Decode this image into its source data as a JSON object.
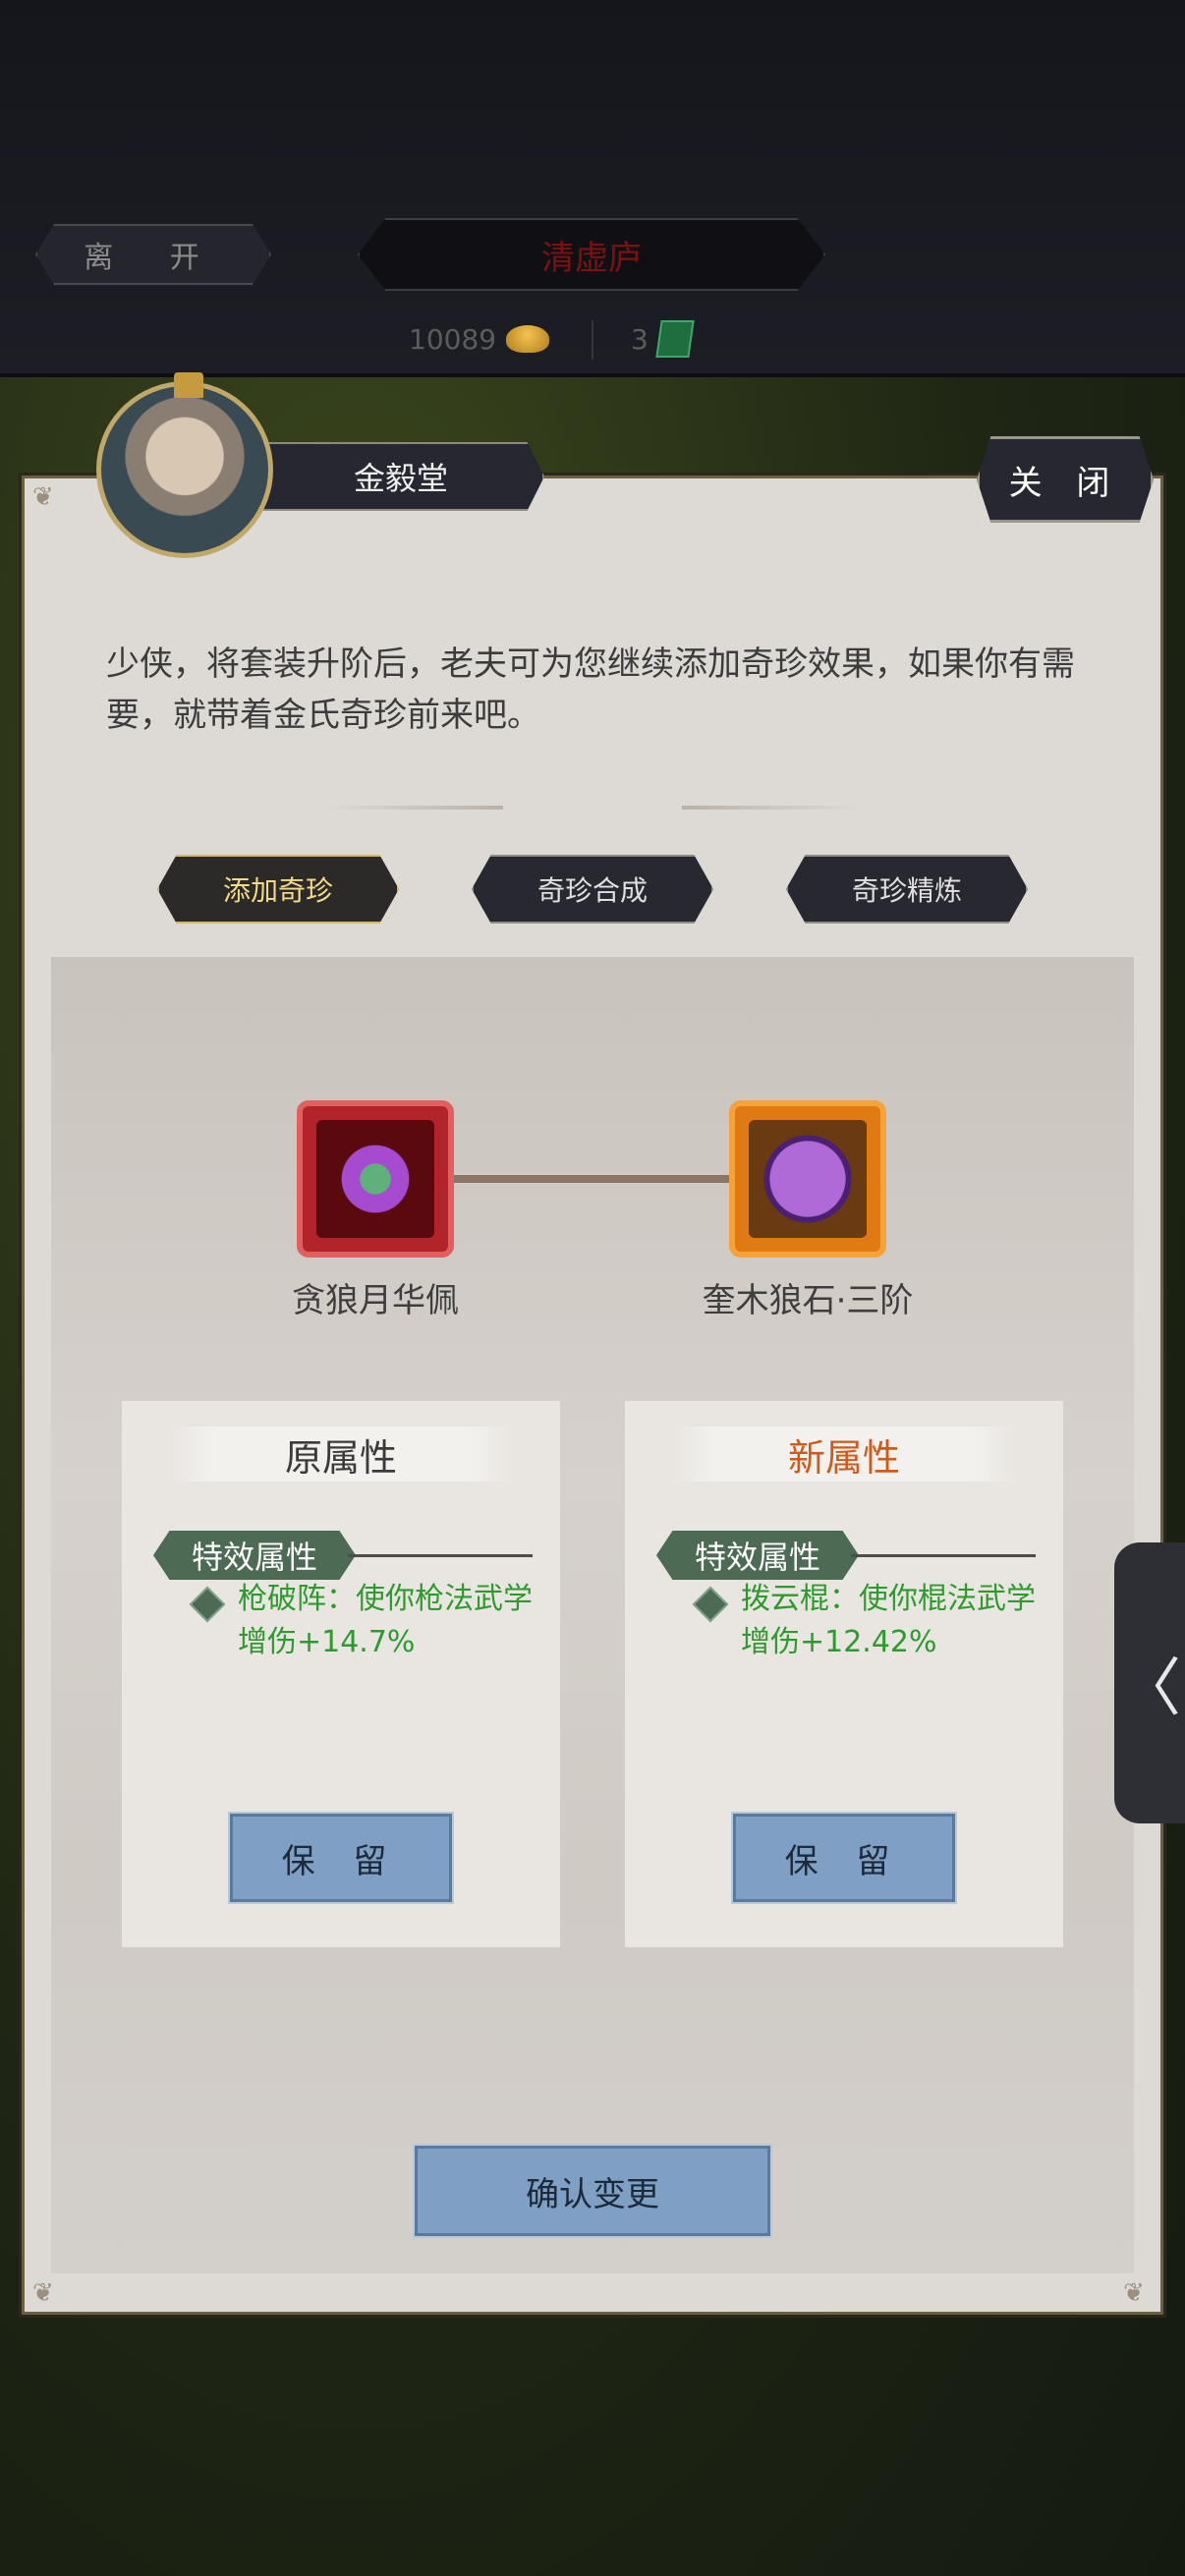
{
  "header": {
    "leave_label": "离 开",
    "location_title": "清虚庐",
    "gold_amount": "10089",
    "jade_amount": "3"
  },
  "npc": {
    "name": "金毅堂",
    "close_label": "关 闭",
    "dialog": "少侠，将套装升阶后，老夫可为您继续添加奇珍效果，如果你有需要，就带着金氏奇珍前来吧。"
  },
  "tabs": [
    {
      "label": "添加奇珍",
      "active": true
    },
    {
      "label": "奇珍合成",
      "active": false
    },
    {
      "label": "奇珍精炼",
      "active": false
    }
  ],
  "items": {
    "left_name": "贪狼月华佩",
    "right_name": "奎木狼石·三阶"
  },
  "cards": {
    "original": {
      "title": "原属性",
      "tag": "特效属性",
      "text": "枪破阵：使你枪法武学增伤+14.7%",
      "keep_label": "保 留"
    },
    "new": {
      "title": "新属性",
      "tag": "特效属性",
      "text": "拨云棍：使你棍法武学增伤+12.42%",
      "keep_label": "保 留"
    }
  },
  "confirm_label": "确认变更",
  "side_handle_glyph": "〈",
  "colors": {
    "accent_green": "#2e9a2e",
    "new_title": "#d05a1a",
    "button_blue": "#7f9fc4"
  }
}
